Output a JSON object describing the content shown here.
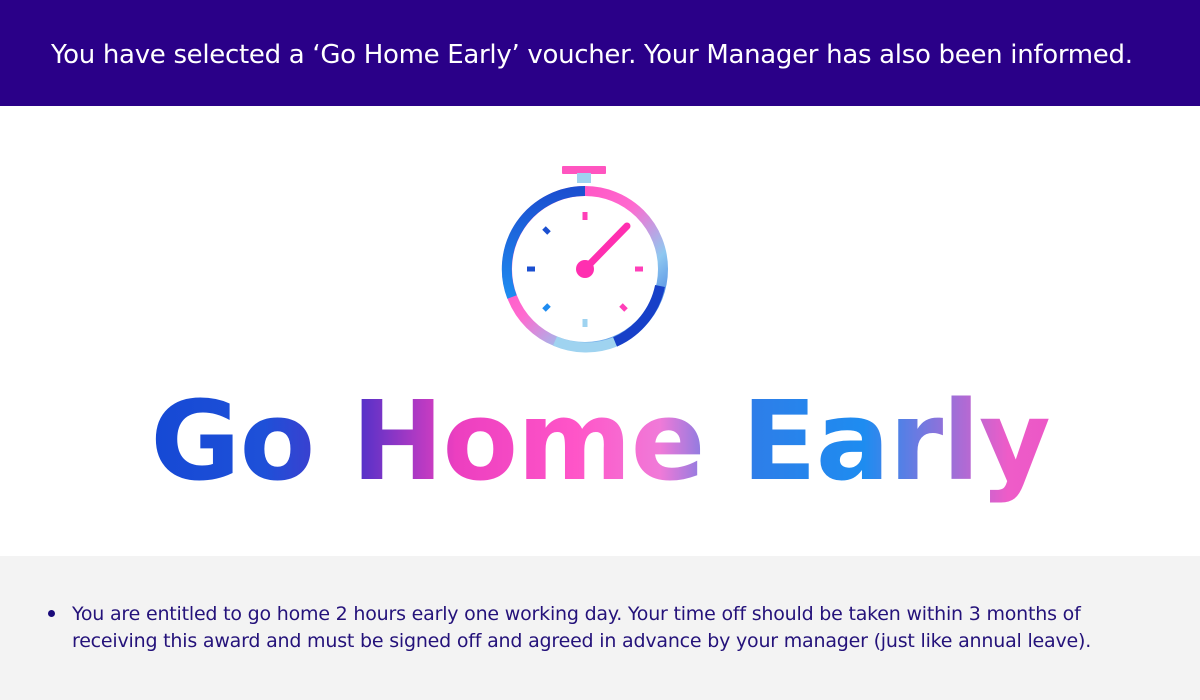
{
  "banner": {
    "message": "You have selected a ‘Go Home Early’ voucher. Your Manager has also been informed."
  },
  "hero": {
    "icon": "stopwatch-icon",
    "title": "Go Home Early"
  },
  "details": {
    "items": [
      "You are entitled to go home 2 hours early one working day. Your time off should be taken within 3 months of receiving this award and must be signed off and agreed in advance by your manager (just like annual leave)."
    ]
  },
  "colors": {
    "banner_bg": "#2a0088",
    "accent_blue": "#1b5ad8",
    "accent_pink": "#ff3fc0",
    "footer_bg": "#f3f3f3",
    "body_text": "#24127a"
  }
}
